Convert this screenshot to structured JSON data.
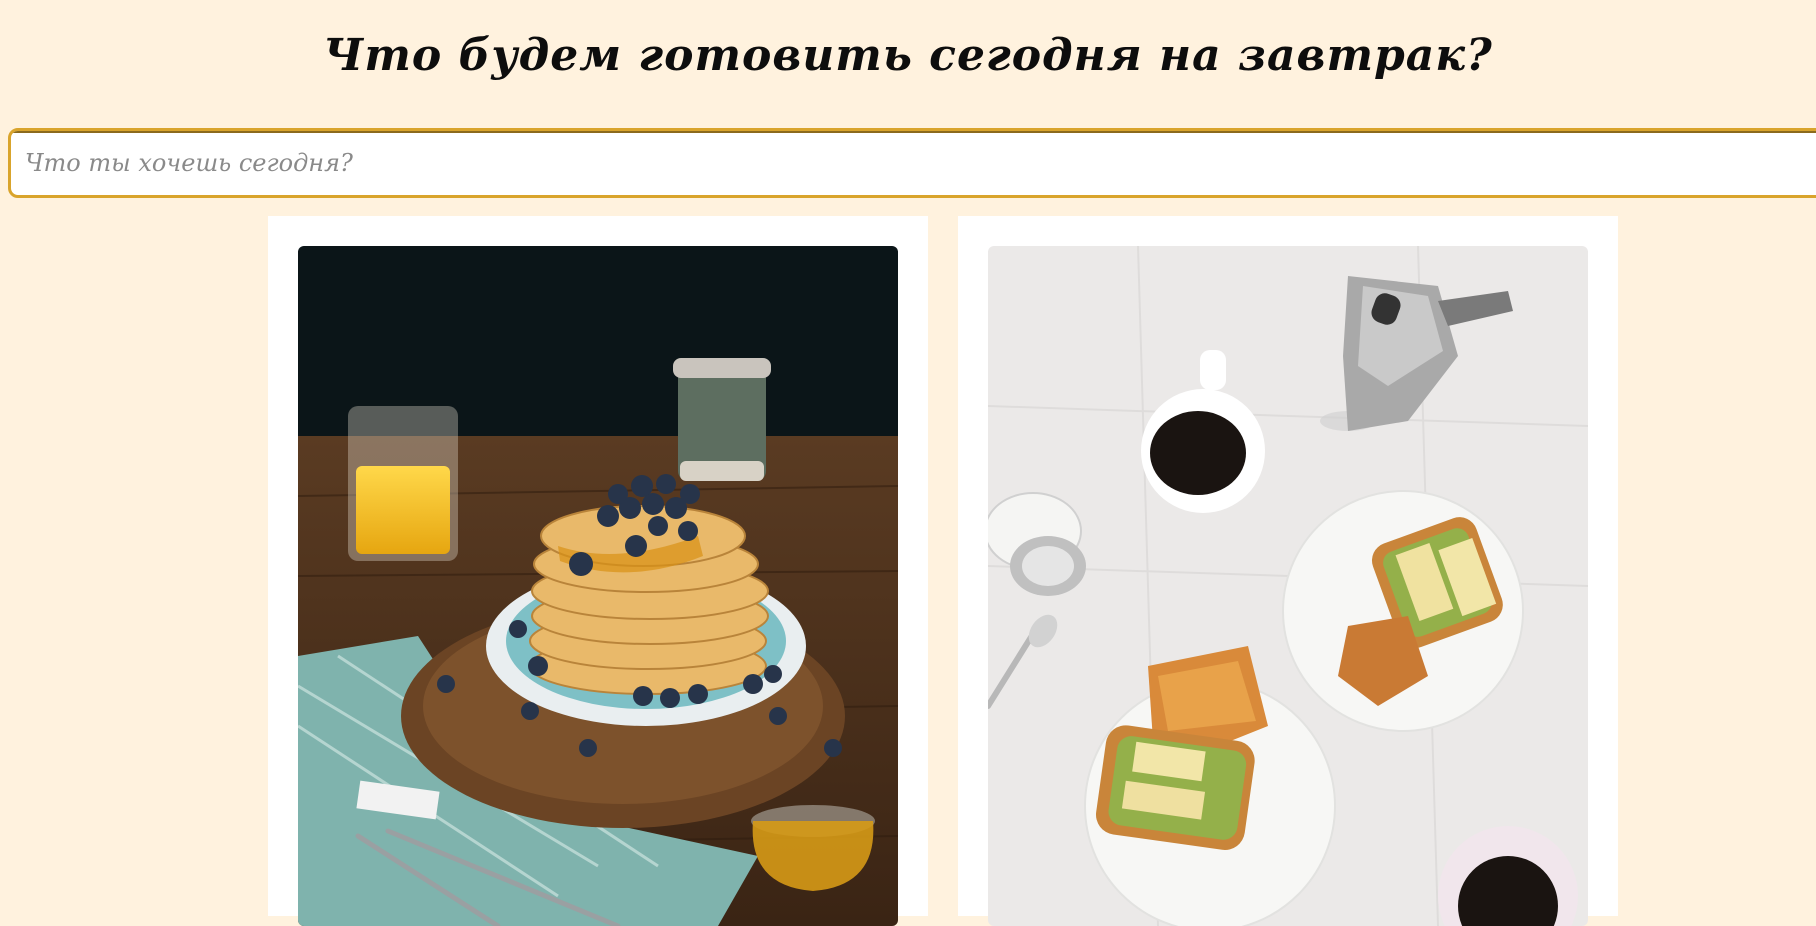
{
  "header": {
    "title": "Что будем готовить сегодня на завтрак?"
  },
  "search": {
    "placeholder": "Что ты хочешь сегодня?",
    "value": ""
  },
  "recipes": [
    {
      "image": "pancakes-blueberries-photo"
    },
    {
      "image": "avocado-toast-coffee-photo"
    }
  ],
  "colors": {
    "background": "#fff2de",
    "search_border": "#d9a42c",
    "card": "#ffffff"
  }
}
